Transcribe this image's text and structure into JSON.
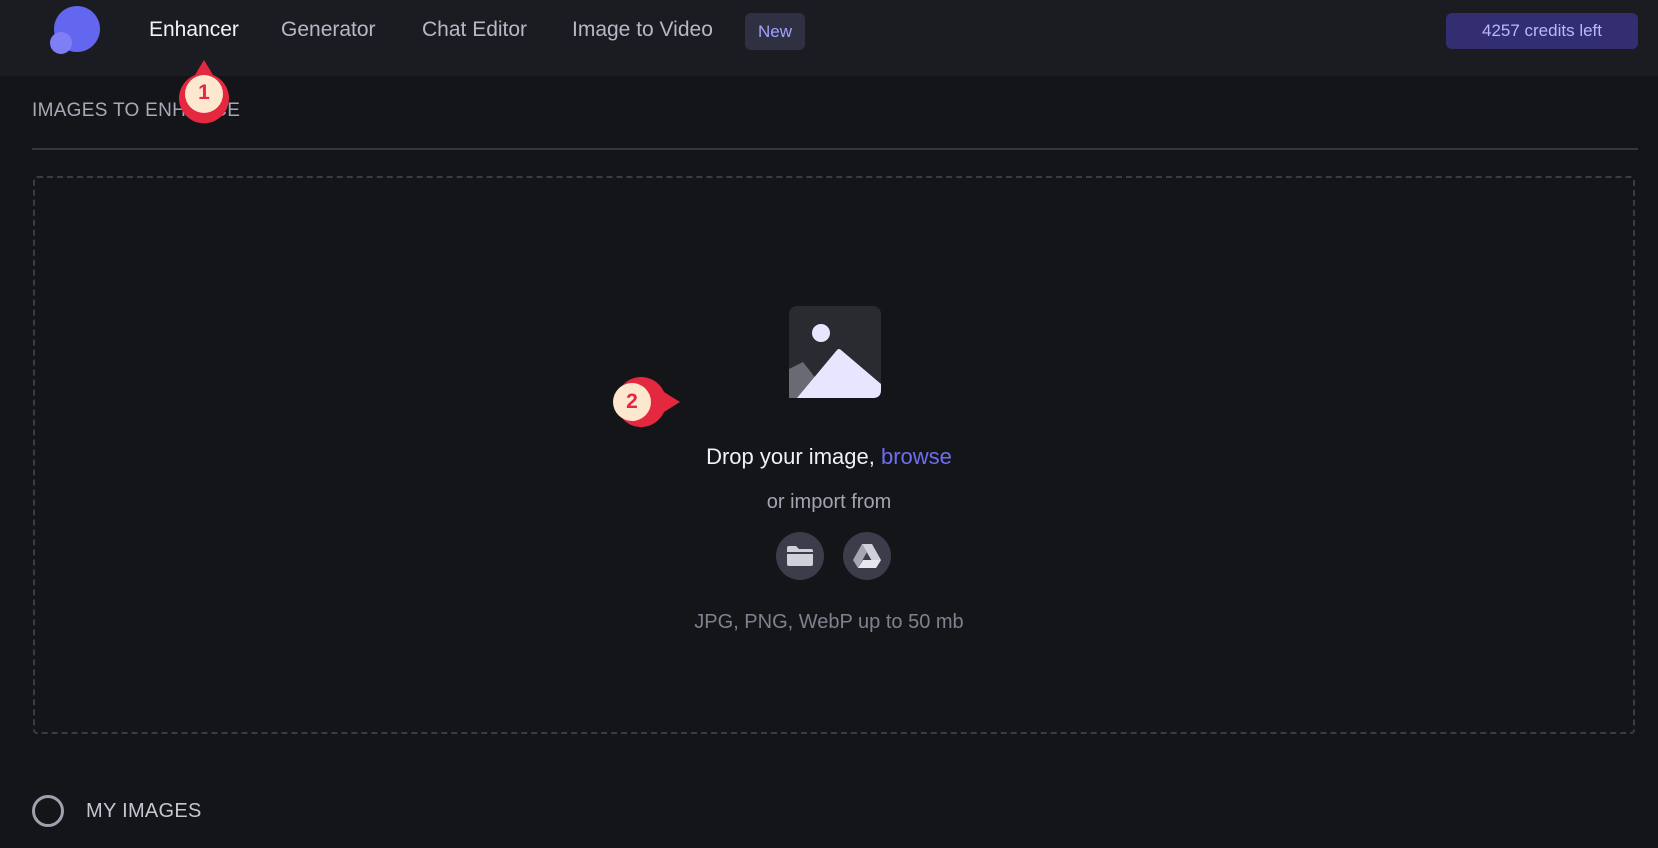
{
  "nav": {
    "items": [
      {
        "label": "Enhancer",
        "active": true
      },
      {
        "label": "Generator",
        "active": false
      },
      {
        "label": "Chat Editor",
        "active": false
      },
      {
        "label": "Image to Video",
        "active": false
      }
    ],
    "new_badge": "New",
    "credits": "4257 credits left"
  },
  "section": {
    "title": "IMAGES TO ENHANCE"
  },
  "dropzone": {
    "drop_text": "Drop your image,",
    "browse_link": "browse",
    "import_text": "or import from",
    "import_sources": [
      {
        "icon": "folder-icon"
      },
      {
        "icon": "google-drive-icon"
      }
    ],
    "formats": "JPG, PNG, WebP up to 50 mb"
  },
  "my_images": {
    "label": "MY IMAGES"
  },
  "annotations": [
    "1",
    "2"
  ],
  "colors": {
    "accent": "#6367f0",
    "marker": "#e3283f",
    "background": "#141519"
  }
}
